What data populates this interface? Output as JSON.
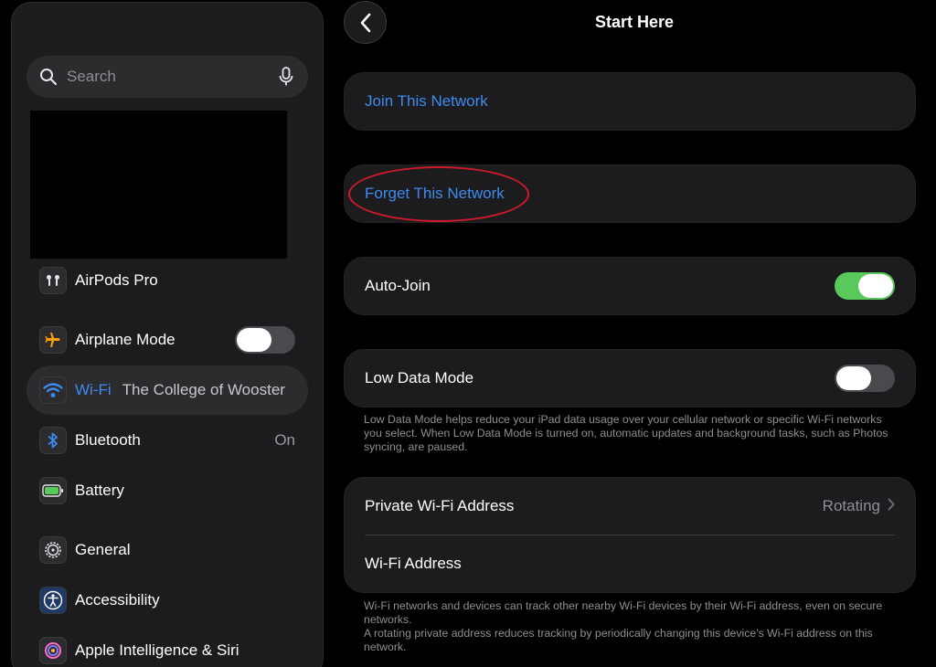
{
  "sidebar": {
    "search_placeholder": "Search",
    "airpods_label": "AirPods Pro",
    "airplane_label": "Airplane Mode",
    "airplane_on": false,
    "wifi_label": "Wi-Fi",
    "wifi_value": "The College of Wooster",
    "bluetooth_label": "Bluetooth",
    "bluetooth_value": "On",
    "battery_label": "Battery",
    "general_label": "General",
    "accessibility_label": "Accessibility",
    "siri_label": "Apple Intelligence & Siri"
  },
  "detail": {
    "title": "Start Here",
    "join_label": "Join This Network",
    "forget_label": "Forget This Network",
    "autojoin_label": "Auto-Join",
    "autojoin_on": true,
    "lowdata_label": "Low Data Mode",
    "lowdata_on": false,
    "lowdata_note": "Low Data Mode helps reduce your iPad data usage over your cellular network or specific Wi-Fi networks you select. When Low Data Mode is turned on, automatic updates and background tasks, such as Photos syncing, are paused.",
    "private_label": "Private Wi-Fi Address",
    "private_value": "Rotating",
    "wifi_address_label": "Wi-Fi Address",
    "address_note_1": "Wi-Fi networks and devices can track other nearby Wi-Fi devices by their Wi-Fi address, even on secure networks.",
    "address_note_2": "A rotating private address reduces tracking by periodically changing this device's Wi-Fi address on this network."
  },
  "colors": {
    "accent_blue": "#3e8bf0",
    "toggle_on": "#5ac95b",
    "annotation_red": "#d0192b"
  },
  "icons": {
    "search": "magnifier-icon",
    "mic": "microphone-icon",
    "airpods": "airpods-icon",
    "airplane": "airplane-icon",
    "wifi": "wifi-icon",
    "bluetooth": "bluetooth-icon",
    "battery": "battery-icon",
    "general": "gear-icon",
    "accessibility": "accessibility-icon",
    "siri": "siri-icon",
    "back": "chevron-left-icon",
    "disclosure": "chevron-right-icon"
  }
}
